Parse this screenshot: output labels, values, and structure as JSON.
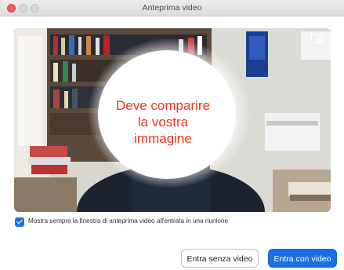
{
  "window": {
    "title": "Anteprima video"
  },
  "preview": {
    "placeholder_line1": "Deve comparire",
    "placeholder_line2": "la vostra immagine"
  },
  "options": {
    "always_show_preview": "Mostra sempre la finestra di anteprima video all'entrata in una riunione",
    "always_show_checked": true
  },
  "buttons": {
    "join_without_video": "Entra senza video",
    "join_with_video": "Entra con video"
  },
  "colors": {
    "primary": "#1a6fe8",
    "placeholder_text": "#e8321e",
    "close": "#ee5f57"
  }
}
